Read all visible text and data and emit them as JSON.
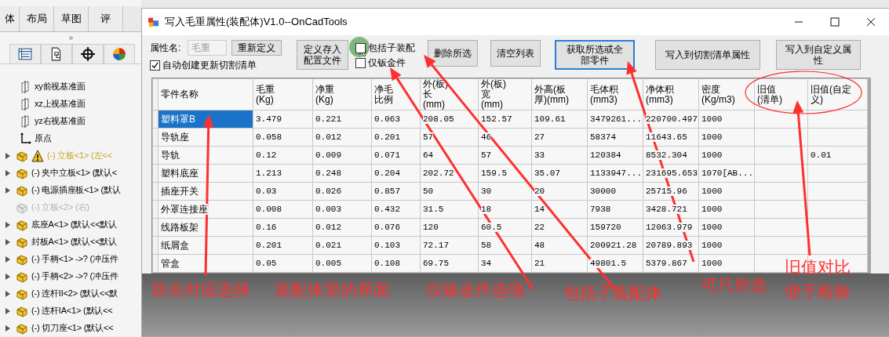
{
  "app_panel": {
    "tabs": [
      {
        "label": "体"
      },
      {
        "label": "布局"
      },
      {
        "label": "草图"
      },
      {
        "label": "评"
      }
    ],
    "tree": [
      {
        "kind": "plane",
        "label": "xy前视基准面"
      },
      {
        "kind": "plane",
        "label": "xz上视基准面"
      },
      {
        "kind": "plane",
        "label": "yz右视基准面"
      },
      {
        "kind": "origin",
        "label": "原点"
      },
      {
        "kind": "part",
        "label": "(-) 立板<1> (左<<",
        "warning": true,
        "suppressed": false
      },
      {
        "kind": "part",
        "label": "(-) 夹中立板<1> (默认<",
        "warning": false,
        "suppressed": false
      },
      {
        "kind": "part",
        "label": "(-) 电源插座板<1> (默认",
        "warning": false,
        "suppressed": false
      },
      {
        "kind": "part",
        "label": "(-) 立板<2> (右)",
        "warning": false,
        "suppressed": true
      },
      {
        "kind": "part",
        "label": "底座A<1> (默认<<默认",
        "warning": false,
        "suppressed": false
      },
      {
        "kind": "part",
        "label": "封板A<1> (默认<<默认",
        "warning": false,
        "suppressed": false
      },
      {
        "kind": "part",
        "label": "(-) 手柄<1> ->? (冲压件",
        "warning": false,
        "suppressed": false
      },
      {
        "kind": "part",
        "label": "(-) 手柄<2> ->? (冲压件",
        "warning": false,
        "suppressed": false
      },
      {
        "kind": "part",
        "label": "(-) 连杆II<2> (默认<<默",
        "warning": false,
        "suppressed": false
      },
      {
        "kind": "part",
        "label": "(-) 连杆IA<1> (默认<<",
        "warning": false,
        "suppressed": false
      },
      {
        "kind": "part",
        "label": "(-) 切刀座<1> (默认<<",
        "warning": false,
        "suppressed": false
      }
    ]
  },
  "window": {
    "title": "写入毛重属性(装配体)V1.0--OnCadTools"
  },
  "form": {
    "property_label": "属性名:",
    "property_field": {
      "value": "毛重",
      "disabled": true
    },
    "redefine_button": "重新定义",
    "auto_cutlist": {
      "label": "自动创建更新切割清单",
      "checked": true
    },
    "save_config_button": "定义存入配置文件",
    "include_subassembly": {
      "label": "包括子装配",
      "checked": false
    },
    "sheetmetal_only": {
      "label": "仅钣金件",
      "checked": false
    },
    "buttons": [
      {
        "label": "删除所选",
        "focused": false
      },
      {
        "label": "清空列表",
        "focused": false
      },
      {
        "label": "获取所选或全部零件",
        "focused": true
      },
      {
        "label": "写入到切割清单属性",
        "focused": false
      },
      {
        "label": "写入到自定义属性",
        "focused": false
      }
    ]
  },
  "table": {
    "columns": [
      "零件名称",
      "毛重(Kg)",
      "净重(Kg)",
      "净毛比例",
      "外(板)长(mm)",
      "外(板)宽(mm)",
      "外高(板厚)(mm)",
      "毛体积(mm3)",
      "净体积(mm3)",
      "密度(Kg/m3)",
      "旧值(清单)",
      "旧值(自定义)"
    ],
    "rows": [
      {
        "selected": true,
        "cells": [
          "塑料罩B",
          "3.479",
          "0.221",
          "0.063",
          "208.05",
          "152.57",
          "109.61",
          "3479261...",
          "220700.497",
          "1000",
          null,
          null
        ]
      },
      {
        "selected": false,
        "cells": [
          "导轨座",
          "0.058",
          "0.012",
          "0.201",
          "57",
          "46",
          "27",
          "58374",
          "11643.65",
          "1000",
          null,
          null
        ]
      },
      {
        "selected": false,
        "cells": [
          "导轨",
          "0.12",
          "0.009",
          "0.071",
          "64",
          "57",
          "33",
          "120384",
          "8532.304",
          "1000",
          null,
          "0.01"
        ]
      },
      {
        "selected": false,
        "cells": [
          "塑料底座",
          "1.213",
          "0.248",
          "0.204",
          "202.72",
          "159.5",
          "35.07",
          "1133947...",
          "231695.653",
          "1070[AB...",
          null,
          null
        ]
      },
      {
        "selected": false,
        "cells": [
          "插座开关",
          "0.03",
          "0.026",
          "0.857",
          "50",
          "30",
          "20",
          "30000",
          "25715.96",
          "1000",
          null,
          null
        ]
      },
      {
        "selected": false,
        "cells": [
          "外罩连接座",
          "0.008",
          "0.003",
          "0.432",
          "31.5",
          "18",
          "14",
          "7938",
          "3428.721",
          "1000",
          null,
          null
        ]
      },
      {
        "selected": false,
        "cells": [
          "线路板架",
          "0.16",
          "0.012",
          "0.076",
          "120",
          "60.5",
          "22",
          "159720",
          "12063.979",
          "1000",
          null,
          null
        ]
      },
      {
        "selected": false,
        "cells": [
          "纸屑盒",
          "0.201",
          "0.021",
          "0.103",
          "72.17",
          "58",
          "48",
          "200921.28",
          "20789.893",
          "1000",
          null,
          null
        ]
      },
      {
        "selected": false,
        "cells": [
          "管盒",
          "0.05",
          "0.005",
          "0.108",
          "69.75",
          "34",
          "21",
          "49801.5",
          "5379.867",
          "1000",
          null,
          null
        ]
      }
    ]
  },
  "annotations": [
    {
      "text": "双击对应选择"
    },
    {
      "text": "装配体里的界面"
    },
    {
      "text": "仅钣金件选项"
    },
    {
      "text": "包括子装配体"
    },
    {
      "text": "可只所选"
    },
    {
      "text": "旧值对比"
    },
    {
      "text": "便于检验"
    }
  ]
}
